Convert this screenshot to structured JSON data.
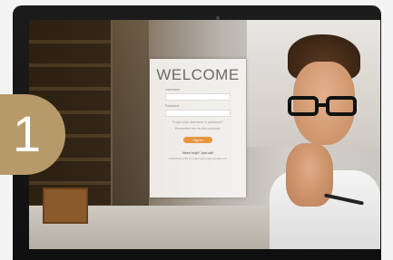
{
  "step": {
    "number": "1"
  },
  "login": {
    "title": "WELCOME",
    "username_label": "Username",
    "password_label": "Password",
    "forgot_text": "Forgot your username or password?",
    "remember_text": "Remember me on this computer",
    "signin_label": "Sign In",
    "help_text": "Need help? Just call",
    "contact_text": "1-800-555-1234 or email support@example.com"
  },
  "colors": {
    "badge": "#b79a6a",
    "signin_button": "#e7963c"
  }
}
